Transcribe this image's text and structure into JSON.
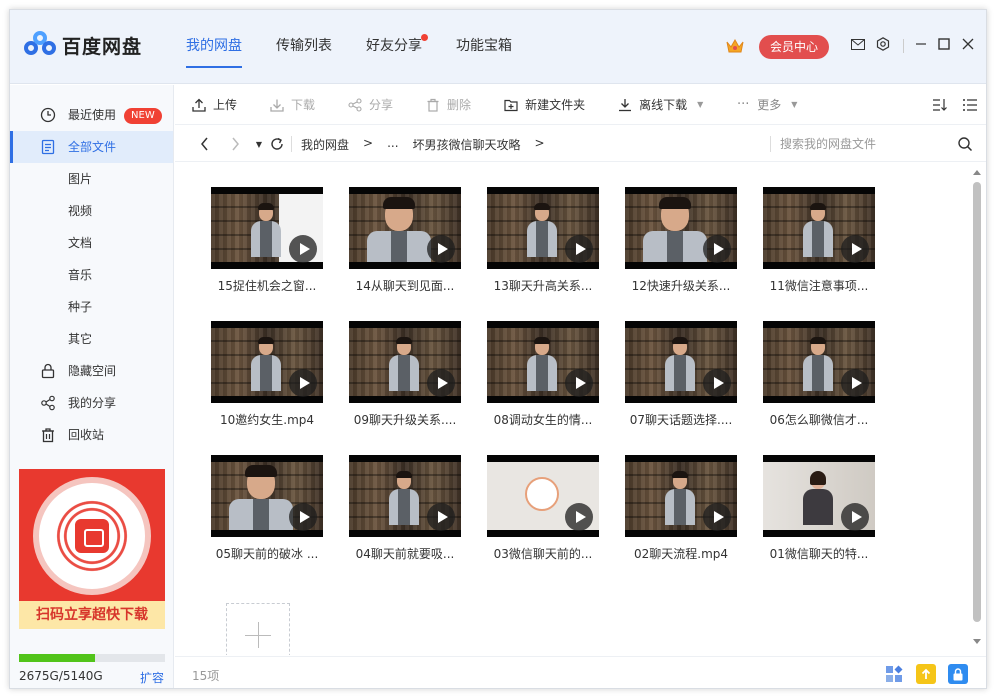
{
  "app": {
    "name": "百度网盘"
  },
  "nav": [
    {
      "label": "我的网盘",
      "active": true
    },
    {
      "label": "传输列表"
    },
    {
      "label": "好友分享",
      "dot": true
    },
    {
      "label": "功能宝箱"
    }
  ],
  "header": {
    "vip_label": "会员中心"
  },
  "sidebar": {
    "items": [
      {
        "label": "最近使用",
        "badge": "NEW",
        "icon": "clock-icon"
      },
      {
        "label": "全部文件",
        "icon": "file-icon",
        "active": true
      },
      {
        "label": "图片"
      },
      {
        "label": "视频"
      },
      {
        "label": "文档"
      },
      {
        "label": "音乐"
      },
      {
        "label": "种子"
      },
      {
        "label": "其它"
      },
      {
        "label": "隐藏空间",
        "icon": "lock-icon"
      },
      {
        "label": "我的分享",
        "icon": "share-icon"
      },
      {
        "label": "回收站",
        "icon": "trash-icon"
      }
    ],
    "promo_text": "扫码立享超快下载",
    "quota": {
      "used_fraction": 0.52,
      "text": "2675G/5140G",
      "expand_label": "扩容"
    }
  },
  "toolbar": {
    "upload": "上传",
    "download": "下载",
    "share": "分享",
    "delete": "删除",
    "new_folder": "新建文件夹",
    "offline_download": "离线下载",
    "more": "更多"
  },
  "address": {
    "crumbs": [
      "我的网盘",
      ">",
      "...",
      "坏男孩微信聊天攻略",
      ">"
    ],
    "search_placeholder": "搜索我的网盘文件"
  },
  "files": [
    {
      "name": "15捉住机会之窗...",
      "style": "hasphone"
    },
    {
      "name": "14从聊天到见面...",
      "style": "close"
    },
    {
      "name": "13聊天升高关系...",
      "style": "shelf"
    },
    {
      "name": "12快速升级关系...",
      "style": "close"
    },
    {
      "name": "11微信注意事项...",
      "style": "shelf"
    },
    {
      "name": "10邀约女生.mp4",
      "style": "shelf"
    },
    {
      "name": "09聊天升级关系....",
      "style": "shelf"
    },
    {
      "name": "08调动女生的情...",
      "style": "shelf"
    },
    {
      "name": "07聊天话题选择....",
      "style": "shelf"
    },
    {
      "name": "06怎么聊微信才...",
      "style": "shelf"
    },
    {
      "name": "05聊天前的破冰 ...",
      "style": "close"
    },
    {
      "name": "04聊天前就要吸...",
      "style": "shelf"
    },
    {
      "name": "03微信聊天前的...",
      "style": "white"
    },
    {
      "name": "02聊天流程.mp4",
      "style": "shelf"
    },
    {
      "name": "01微信聊天的特...",
      "style": "woman"
    }
  ],
  "status": {
    "count": "15项"
  },
  "colors": {
    "accent": "#2f6fe4",
    "vip": "#e24e4e",
    "badge": "#f04134",
    "quota": "#52c41a",
    "promo": "#e8392f"
  }
}
